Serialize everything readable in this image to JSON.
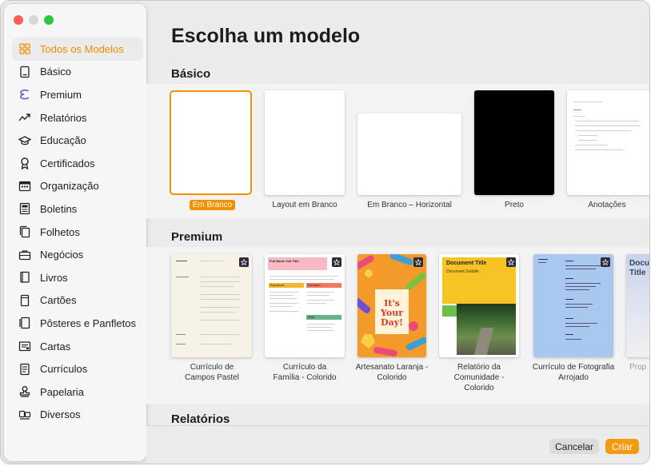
{
  "window": {
    "controls": [
      "close",
      "minimize",
      "zoom"
    ]
  },
  "sidebar": {
    "items": [
      {
        "label": "Todos os Modelos",
        "icon": "grid-icon",
        "active": true
      },
      {
        "label": "Básico",
        "icon": "document-icon"
      },
      {
        "label": "Premium",
        "icon": "premium-icon"
      },
      {
        "label": "Relatórios",
        "icon": "trend-icon"
      },
      {
        "label": "Educação",
        "icon": "graduation-cap-icon"
      },
      {
        "label": "Certificados",
        "icon": "ribbon-icon"
      },
      {
        "label": "Organização",
        "icon": "calendar-icon"
      },
      {
        "label": "Boletins",
        "icon": "newsletter-icon"
      },
      {
        "label": "Folhetos",
        "icon": "flyer-icon"
      },
      {
        "label": "Negócios",
        "icon": "briefcase-icon"
      },
      {
        "label": "Livros",
        "icon": "book-icon"
      },
      {
        "label": "Cartões",
        "icon": "card-icon"
      },
      {
        "label": "Pôsteres e Panfletos",
        "icon": "poster-icon"
      },
      {
        "label": "Cartas",
        "icon": "letter-icon"
      },
      {
        "label": "Currículos",
        "icon": "resume-icon"
      },
      {
        "label": "Papelaria",
        "icon": "stamp-icon"
      },
      {
        "label": "Diversos",
        "icon": "misc-icon"
      }
    ]
  },
  "main": {
    "title": "Escolha um modelo",
    "sections": {
      "basic": {
        "heading": "Básico",
        "templates": [
          {
            "label": "Em Branco",
            "selected": true
          },
          {
            "label": "Layout em Branco"
          },
          {
            "label": "Em Branco – Horizontal"
          },
          {
            "label": "Preto"
          },
          {
            "label": "Anotações"
          }
        ]
      },
      "premium": {
        "heading": "Premium",
        "templates": [
          {
            "label_line1": "Currículo de",
            "label_line2": "Campos Pastel"
          },
          {
            "label_line1": "Currículo da",
            "label_line2": "Família - Colorido",
            "thumb_title": "Full Name Job Title",
            "thumb_sections": [
              "Experience",
              "Education",
              "Skills"
            ]
          },
          {
            "label_line1": "Artesanato Laranja -",
            "label_line2": "Colorido",
            "thumb_text": "It's Your Day!"
          },
          {
            "label_line1": "Relatório da",
            "label_line2": "Comunidade -",
            "label_line3": "Colorido",
            "thumb_title": "Document Title",
            "thumb_subtitle": "Document Subtitle"
          },
          {
            "label_line1": "Currículo de Fotografia",
            "label_line2": "Arrojado"
          },
          {
            "label_line1": "Prop",
            "thumb_text": "Docum Title"
          }
        ]
      },
      "reports": {
        "heading": "Relatórios"
      }
    }
  },
  "footer": {
    "cancel_label": "Cancelar",
    "create_label": "Criar"
  },
  "colors": {
    "accent": "#f39200",
    "sidebar_active_text": "#f08c00"
  }
}
